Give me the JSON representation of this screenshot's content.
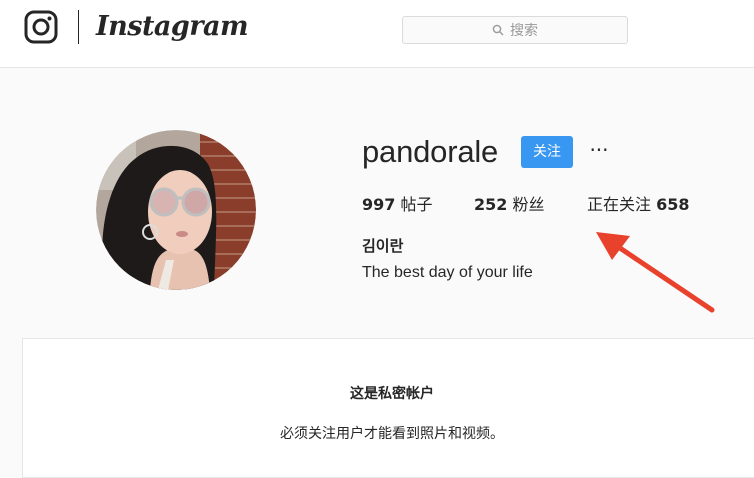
{
  "header": {
    "wordmark": "Instagram",
    "search": {
      "placeholder": "搜索"
    }
  },
  "profile": {
    "username": "pandorale",
    "follow_label": "关注",
    "more_label": "···",
    "stats": {
      "posts": {
        "count": "997",
        "label": "帖子"
      },
      "followers": {
        "count": "252",
        "label": "粉丝"
      },
      "following": {
        "label": "正在关注",
        "count": "658"
      }
    },
    "full_name": "김이란",
    "bio": "The best day of your life"
  },
  "private_notice": {
    "title": "这是私密帐户",
    "subtitle": "必须关注用户才能看到照片和视频。"
  },
  "colors": {
    "accent": "#3897f0",
    "annotation_arrow": "#e8412c",
    "background": "#fafafa"
  },
  "icons": {
    "logo": "instagram-camera-icon",
    "search": "search-icon",
    "annotation": "red-arrow-icon"
  }
}
